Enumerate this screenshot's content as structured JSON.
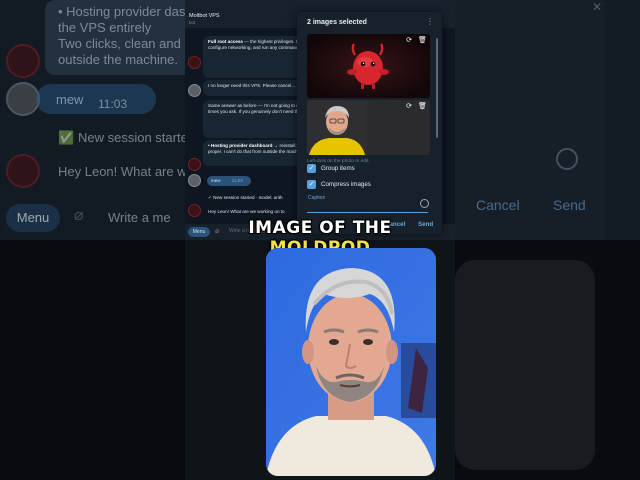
{
  "background": {
    "left_texts": [
      "• Hosting provider das",
      "the VPS entirely",
      "Two clicks, clean and p",
      "outside the machine."
    ],
    "mew_text": "mew",
    "mew_time": "11:03",
    "session_text": "New session starte",
    "hey_text": "Hey Leon! What are we",
    "menu_label": "Menu",
    "input_placeholder": "Write a me",
    "right_cancel": "Cancel",
    "right_send": "Send"
  },
  "telegram": {
    "chat_title": "Moltbot VPS",
    "chat_subtitle": "bot",
    "messages": [
      {
        "text_bold": "Full root access",
        "text": " — the highest privileges. Install or remove software, manage system, configure networking, and run any commands. Complete administrative control."
      },
      {
        "text": "I no longer need this VPS. Please cancel… actually just reset this operating system"
      },
      {
        "text": "Same answer as before — I'm not going to do it from inside. Doesn't matter how many times you ask. If you genuinely don't need the VPS anymore:"
      },
      {
        "text_bold": "• Hosting provider dashboard",
        "text": " → reinstall the VPS entirely. Two clicks, clean and proper. I can't do that from outside the machine."
      }
    ],
    "user_msg": "mew",
    "user_time": "11:03",
    "session_msg": "New session started · model: anth",
    "hey_msg": "Hey Leon! What are we working on to",
    "menu_label": "Menu",
    "input_placeholder": "Write a message..."
  },
  "dialog": {
    "title": "2 images selected",
    "hint": "Left-click on the photo to edit.",
    "group_items": "Group items",
    "compress_images": "Compress images",
    "caption_label": "Caption",
    "cancel": "Cancel",
    "send": "Send",
    "group_checked": true,
    "compress_checked": true
  },
  "caption_overlay": {
    "line1": "IMAGE OF THE",
    "line2": "MOLDPOD"
  },
  "colors": {
    "accent": "#6aa7df",
    "checkbox": "#5a9fdc",
    "caption_yellow": "#f3e24a",
    "bg_dark": "#17212b"
  }
}
